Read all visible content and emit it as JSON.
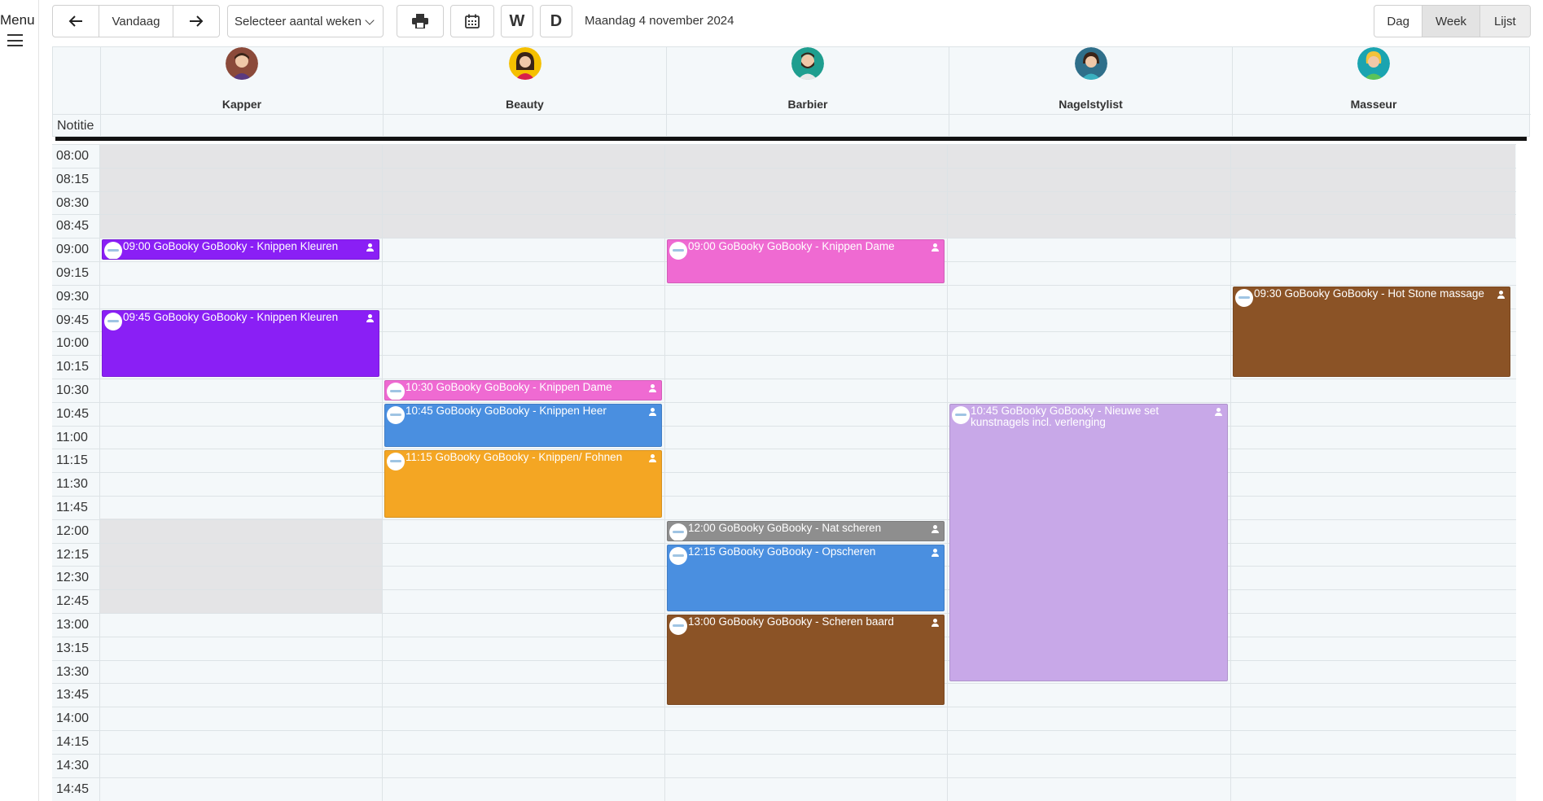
{
  "menu": {
    "label": "Menu",
    "icon": "hamburger-icon"
  },
  "toolbar": {
    "prev_icon": "←",
    "today_label": "Vandaag",
    "next_icon": "→",
    "weeks_select": "Selecteer aantal weken",
    "print_icon": "printer-icon",
    "calendar_icon": "calendar-icon",
    "week_short": "W",
    "day_short": "D",
    "current_date": "Maandag 4 november 2024"
  },
  "views": {
    "day": "Dag",
    "week": "Week",
    "list": "Lijst",
    "active": "Week"
  },
  "notitie_label": "Notitie",
  "columns": [
    {
      "name": "Kapper",
      "avatar_color": "#8b4a3a"
    },
    {
      "name": "Beauty",
      "avatar_color": "#f5c000"
    },
    {
      "name": "Barbier",
      "avatar_color": "#1f9e8f"
    },
    {
      "name": "Nagelstylist",
      "avatar_color": "#2f6f8a"
    },
    {
      "name": "Masseur",
      "avatar_color": "#1aa4b0"
    }
  ],
  "times": [
    "08:00",
    "08:15",
    "08:30",
    "08:45",
    "09:00",
    "09:15",
    "09:30",
    "09:45",
    "10:00",
    "10:15",
    "10:30",
    "10:45",
    "11:00",
    "11:15",
    "11:30",
    "11:45",
    "12:00",
    "12:15",
    "12:30",
    "12:45",
    "13:00",
    "13:15",
    "13:30",
    "13:45",
    "14:00",
    "14:15",
    "14:30",
    "14:45"
  ],
  "events": [
    {
      "column": 0,
      "start": "09:00",
      "slots": 1,
      "color": "#8a1ff5",
      "title": "09:00 GoBooky GoBooky - Knippen Kleuren"
    },
    {
      "column": 0,
      "start": "09:45",
      "slots": 3,
      "color": "#8a1ff5",
      "title": "09:45 GoBooky GoBooky - Knippen Kleuren"
    },
    {
      "column": 1,
      "start": "10:30",
      "slots": 1,
      "color": "#ef6ad2",
      "title": "10:30 GoBooky GoBooky - Knippen Dame"
    },
    {
      "column": 1,
      "start": "10:45",
      "slots": 2,
      "color": "#4a8fe0",
      "title": "10:45 GoBooky GoBooky - Knippen Heer"
    },
    {
      "column": 1,
      "start": "11:15",
      "slots": 3,
      "color": "#f4a623",
      "title": "11:15 GoBooky GoBooky - Knippen/ Fohnen"
    },
    {
      "column": 2,
      "start": "09:00",
      "slots": 2,
      "color": "#ef6ad2",
      "title": "09:00 GoBooky GoBooky - Knippen Dame"
    },
    {
      "column": 2,
      "start": "12:00",
      "slots": 1,
      "color": "#8e8e8e",
      "title": "12:00 GoBooky GoBooky - Nat scheren"
    },
    {
      "column": 2,
      "start": "12:15",
      "slots": 3,
      "color": "#4a8fe0",
      "title": "12:15 GoBooky GoBooky - Opscheren"
    },
    {
      "column": 2,
      "start": "13:00",
      "slots": 4,
      "color": "#8b5326",
      "title": "13:00 GoBooky GoBooky - Scheren baard"
    },
    {
      "column": 3,
      "start": "10:45",
      "slots": 12,
      "color": "#c8a8e8",
      "title": "10:45 GoBooky GoBooky - Nieuwe set kunstnagels incl. verlenging"
    },
    {
      "column": 4,
      "start": "09:30",
      "slots": 4,
      "color": "#8b5326",
      "title": "09:30 GoBooky GoBooky - Hot Stone massage"
    }
  ]
}
